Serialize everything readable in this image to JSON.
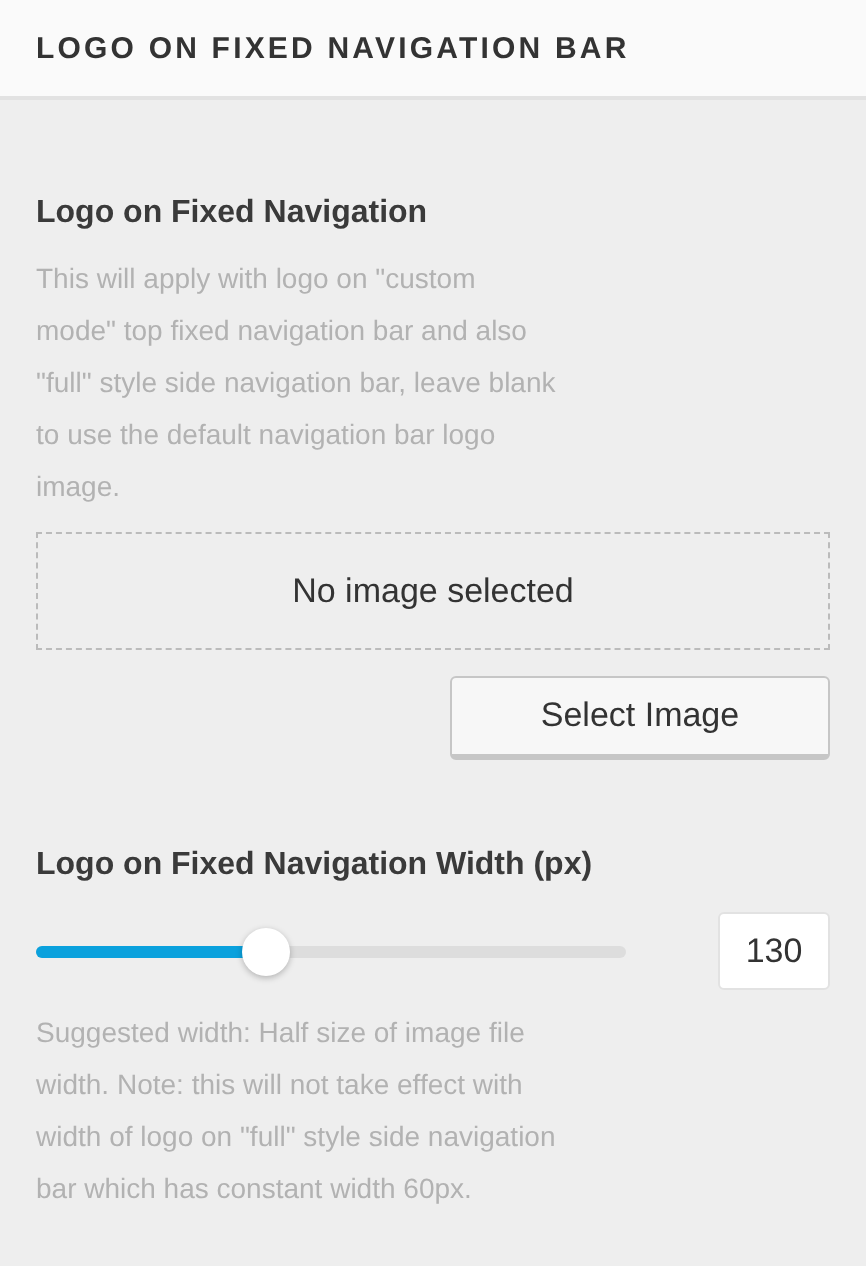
{
  "section_title": "LOGO ON FIXED NAVIGATION BAR",
  "settings": [
    {
      "kind": "image",
      "label": "Logo on Fixed Navigation",
      "description": "This will apply with logo on \"custom mode\" top fixed navigation bar and also \"full\" style side navigation bar, leave blank to use the default navigation bar logo image.",
      "preview": "No image selected",
      "button": "Select Image"
    },
    {
      "kind": "slider",
      "label": "Logo on Fixed Navigation Width (px)",
      "level": 0.39,
      "value": "130",
      "description": "Suggested width: Half size of image file width. Note: this will not take effect with width of logo on \"full\" style side navigation bar which has constant width 60px."
    }
  ]
}
